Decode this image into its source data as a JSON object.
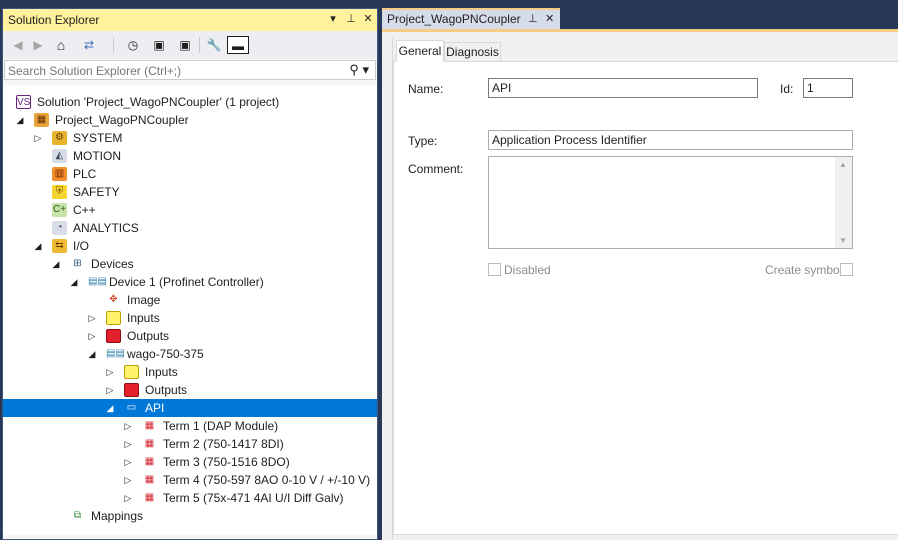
{
  "solution_explorer": {
    "title": "Solution Explorer",
    "title_buttons": {
      "dropdown": "▾",
      "pin": "⊥",
      "close": "✕"
    },
    "toolbar": {
      "back": "◀",
      "forward": "▶",
      "home": "⌂",
      "sync": "⇄",
      "history": "◷",
      "collapse": "▣",
      "properties": "🔧",
      "preview": "▬"
    },
    "search_placeholder": "Search Solution Explorer (Ctrl+;)",
    "tree": [
      {
        "label": "Solution 'Project_WagoPNCoupler' (1 project)",
        "icon": "solution-icon",
        "glyph": "VS",
        "arrow": ""
      },
      {
        "label": "Project_WagoPNCoupler",
        "icon": "project-icon",
        "glyph": "▦",
        "arrow": "◢"
      },
      {
        "label": "SYSTEM",
        "icon": "system-icon",
        "glyph": "⚙",
        "arrow": "▷"
      },
      {
        "label": "MOTION",
        "icon": "motion-icon",
        "glyph": "◭",
        "arrow": ""
      },
      {
        "label": "PLC",
        "icon": "plc-icon",
        "glyph": "▥",
        "arrow": ""
      },
      {
        "label": "SAFETY",
        "icon": "safety-icon",
        "glyph": "⛨",
        "arrow": ""
      },
      {
        "label": "C++",
        "icon": "cpp-icon",
        "glyph": "C+",
        "arrow": ""
      },
      {
        "label": "ANALYTICS",
        "icon": "analytics-icon",
        "glyph": "◔",
        "arrow": ""
      },
      {
        "label": "I/O",
        "icon": "io-icon",
        "glyph": "⇆",
        "arrow": "◢"
      },
      {
        "label": "Devices",
        "icon": "devices-icon",
        "glyph": "⊞",
        "arrow": "◢"
      },
      {
        "label": "Device 1 (Profinet Controller)",
        "icon": "profinet-device-icon",
        "glyph": "▤▤",
        "arrow": "◢"
      },
      {
        "label": "Image",
        "icon": "image-icon",
        "glyph": "✥",
        "arrow": ""
      },
      {
        "label": "Inputs",
        "icon": "inputs-icon",
        "glyph": "",
        "arrow": "▷"
      },
      {
        "label": "Outputs",
        "icon": "outputs-icon",
        "glyph": "",
        "arrow": "▷"
      },
      {
        "label": "wago-750-375",
        "icon": "profinet-device-icon",
        "glyph": "▤▤",
        "arrow": "◢"
      },
      {
        "label": "Inputs",
        "icon": "inputs-icon",
        "glyph": "",
        "arrow": "▷"
      },
      {
        "label": "Outputs",
        "icon": "outputs-icon",
        "glyph": "",
        "arrow": "▷"
      },
      {
        "label": "API",
        "icon": "api-icon",
        "glyph": "▭",
        "arrow": "◢"
      },
      {
        "label": "Term 1 (DAP Module)",
        "icon": "terminal-icon",
        "glyph": "▦",
        "arrow": "▷"
      },
      {
        "label": "Term 2 (750-1417 8DI)",
        "icon": "terminal-icon",
        "glyph": "▦",
        "arrow": "▷"
      },
      {
        "label": "Term 3 (750-1516 8DO)",
        "icon": "terminal-icon",
        "glyph": "▦",
        "arrow": "▷"
      },
      {
        "label": "Term 4 (750-597 8AO 0-10 V / +/-10 V)",
        "icon": "terminal-icon",
        "glyph": "▦",
        "arrow": "▷"
      },
      {
        "label": "Term 5 (75x-471 4AI U/I Diff Galv)",
        "icon": "terminal-icon",
        "glyph": "▦",
        "arrow": "▷"
      },
      {
        "label": "Mappings",
        "icon": "mappings-icon",
        "glyph": "⧉",
        "arrow": ""
      }
    ]
  },
  "document": {
    "tab_title": "Project_WagoPNCoupler",
    "tab_pin": "⊥",
    "tab_close": "✕",
    "tabs": {
      "general": "General",
      "diagnosis": "Diagnosis"
    },
    "fields": {
      "name_label": "Name:",
      "name_value": "API",
      "id_label": "Id:",
      "id_value": "1",
      "type_label": "Type:",
      "type_value": "Application Process Identifier",
      "comment_label": "Comment:",
      "disabled_label": "Disabled",
      "create_symbols_label": "Create symbols"
    }
  },
  "colors": {
    "selection": "#0078d7",
    "title_highlight": "#fff29d",
    "frame": "#293955"
  }
}
